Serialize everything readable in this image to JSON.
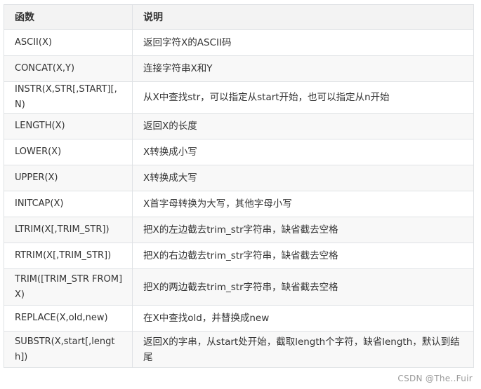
{
  "table": {
    "headers": [
      "函数",
      "说明"
    ],
    "rows": [
      {
        "fn": "ASCII(X)",
        "desc": "返回字符X的ASCII码"
      },
      {
        "fn": "CONCAT(X,Y)",
        "desc": "连接字符串X和Y"
      },
      {
        "fn": "INSTR(X,STR[,START][,N)",
        "desc": "从X中查找str，可以指定从start开始，也可以指定从n开始"
      },
      {
        "fn": "LENGTH(X)",
        "desc": "返回X的长度"
      },
      {
        "fn": "LOWER(X)",
        "desc": "X转换成小写"
      },
      {
        "fn": "UPPER(X)",
        "desc": "X转换成大写"
      },
      {
        "fn": "INITCAP(X)",
        "desc": "X首字母转换为大写，其他字母小写"
      },
      {
        "fn": "LTRIM(X[,TRIM_STR])",
        "desc": "把X的左边截去trim_str字符串，缺省截去空格"
      },
      {
        "fn": "RTRIM(X[,TRIM_STR])",
        "desc": "把X的右边截去trim_str字符串，缺省截去空格"
      },
      {
        "fn": "TRIM([TRIM_STR FROM]X)",
        "desc": "把X的两边截去trim_str字符串，缺省截去空格"
      },
      {
        "fn": "REPLACE(X,old,new)",
        "desc": "在X中查找old，并替换成new"
      },
      {
        "fn": "SUBSTR(X,start[,length])",
        "desc": "返回X的字串，从start处开始，截取length个字符，缺省length，默认到结尾"
      }
    ]
  },
  "watermark": "CSDN @The..Fuir"
}
